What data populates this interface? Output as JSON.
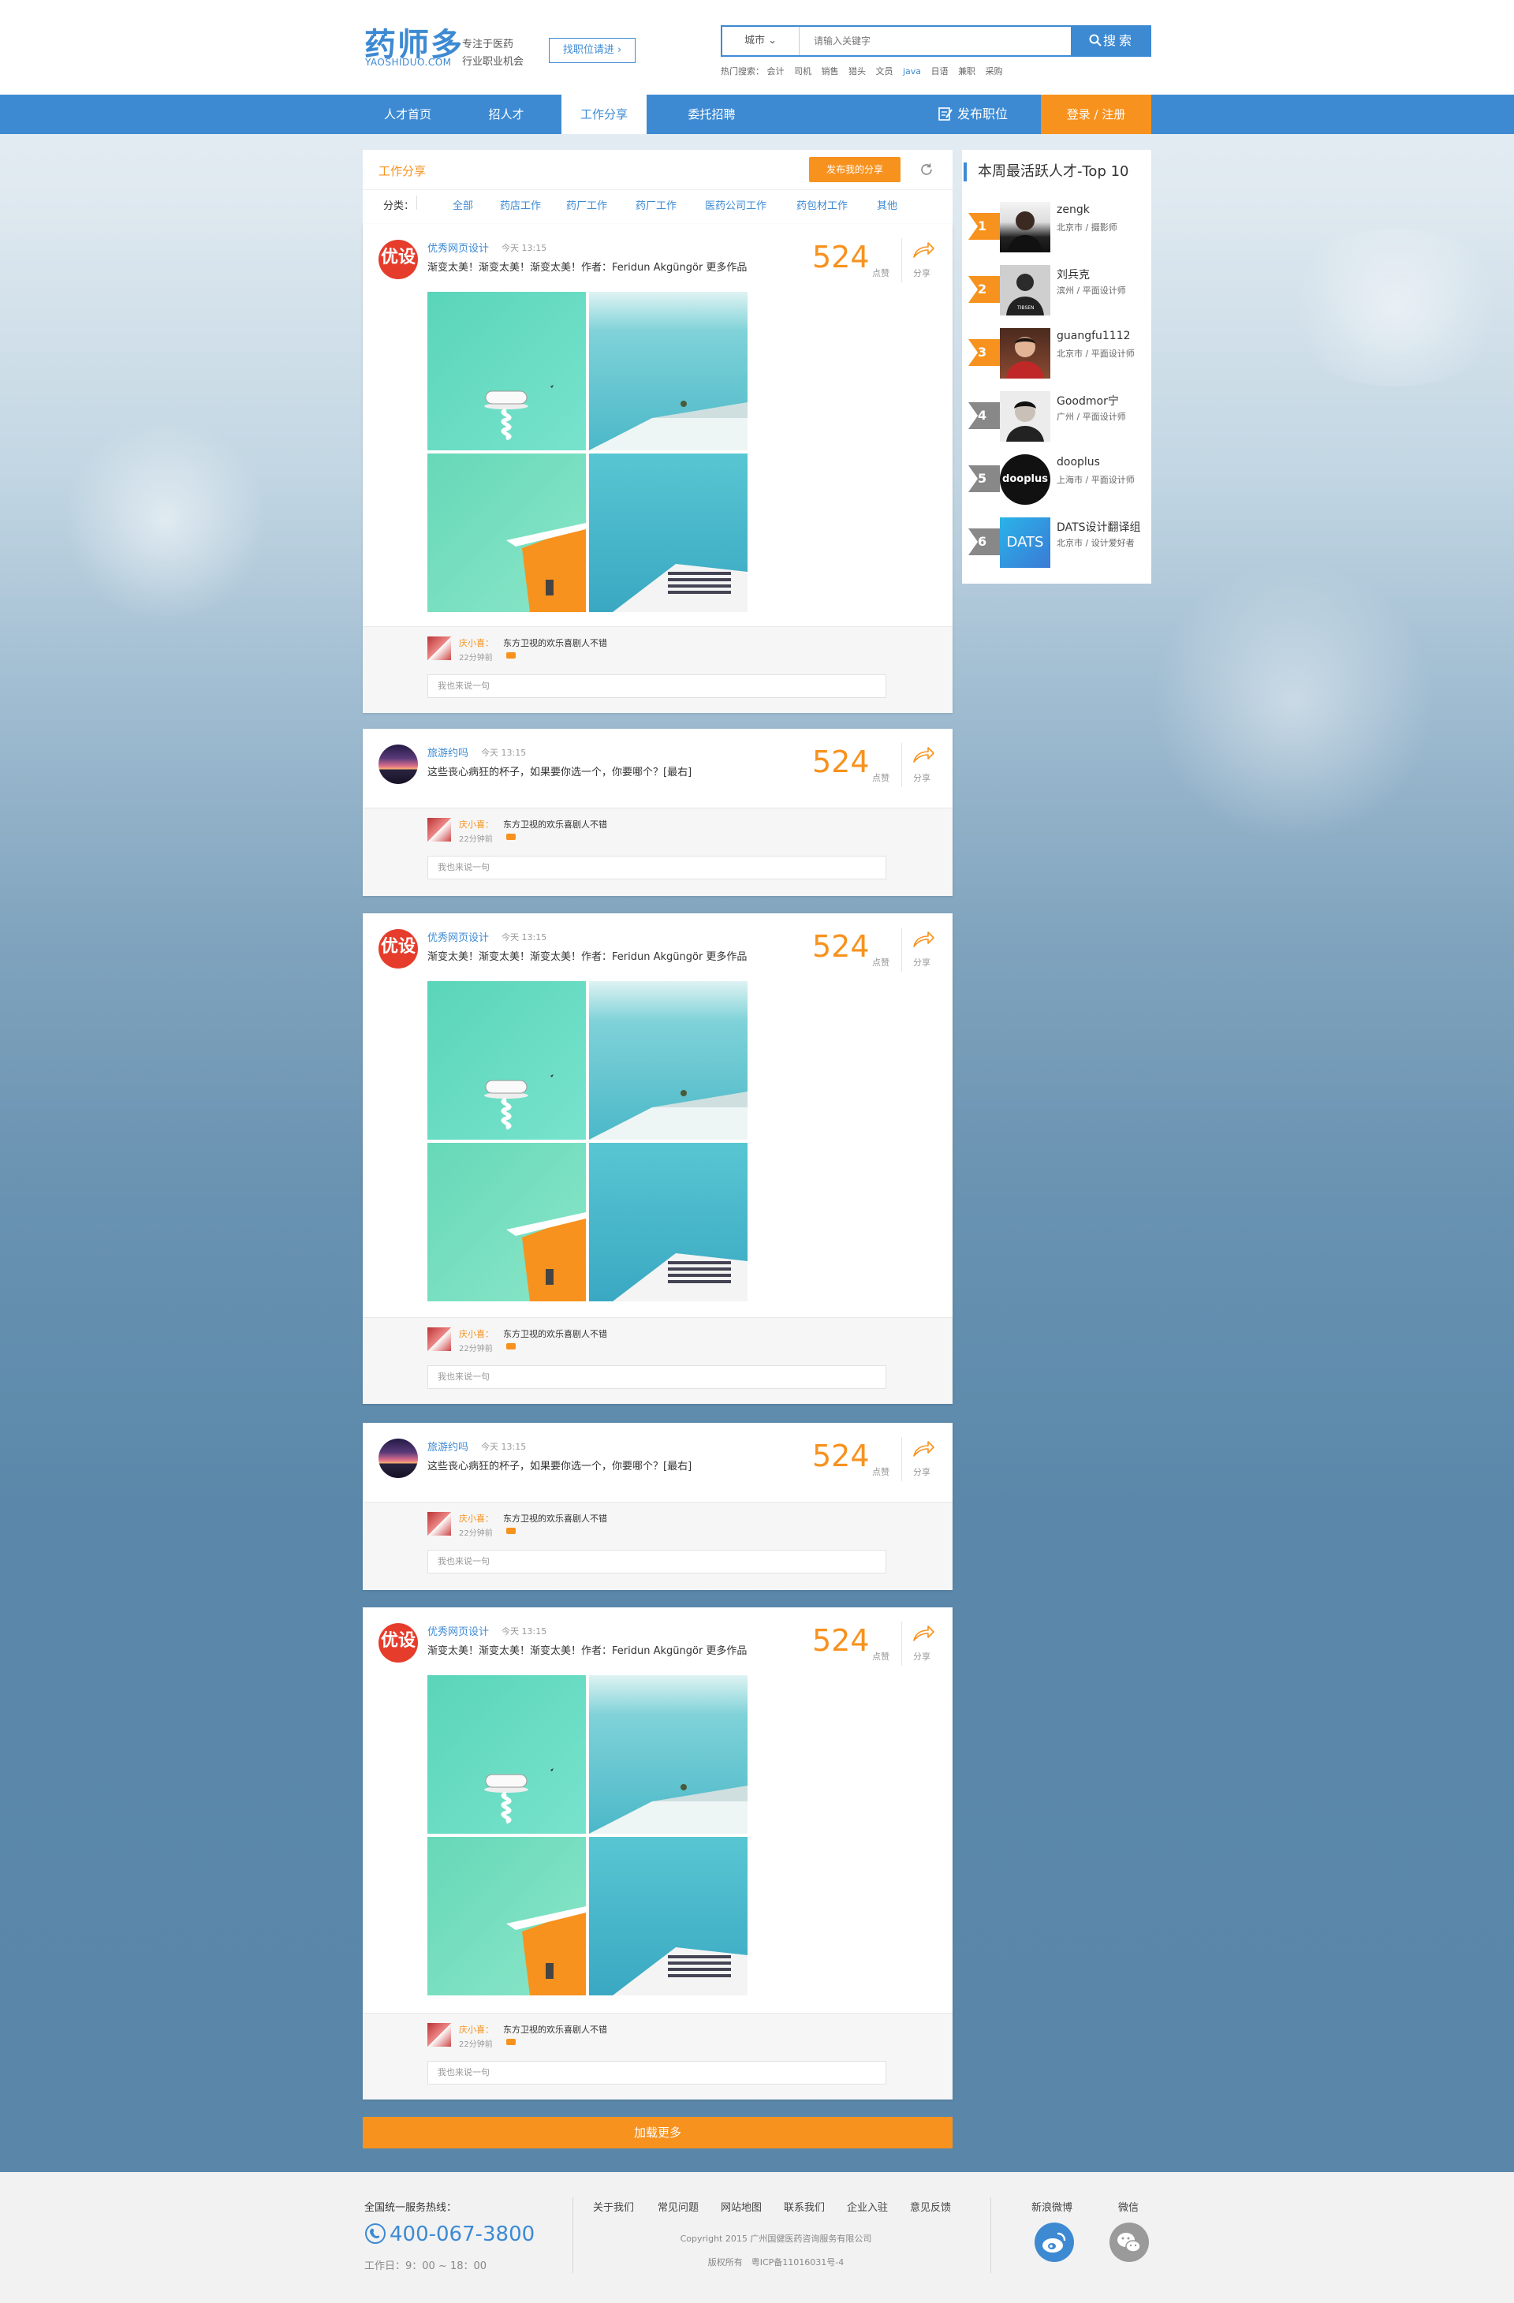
{
  "header": {
    "logo_cn": "药师多",
    "logo_en": "YAOSHIDUO.COM",
    "slogan_line1": "专注于医药",
    "slogan_line2": "行业职业机会",
    "find_job_btn": "找职位请进",
    "city_select": "城市",
    "search_placeholder": "请输入关键字",
    "search_btn": "搜索",
    "hot_label": "热门搜索：",
    "hot_terms": [
      "会计",
      "司机",
      "销售",
      "猎头",
      "文员",
      "java",
      "日语",
      "兼职",
      "采购"
    ]
  },
  "nav": {
    "items": [
      "人才首页",
      "招人才",
      "工作分享",
      "委托招聘"
    ],
    "active_index": 2,
    "post_job": "发布职位",
    "login": "登录 / 注册"
  },
  "feed": {
    "section_title": "工作分享",
    "share_btn": "发布我的分享",
    "category_label": "分类：",
    "categories": [
      "全部",
      "药店工作",
      "药厂工作",
      "药厂工作",
      "医药公司工作",
      "药包材工作",
      "其他"
    ],
    "posts": [
      {
        "user": "优秀网页设计",
        "avatar_text": "优设",
        "time": "今天 13:15",
        "text": "渐变太美！渐变太美！渐变太美！作者：Feridun Akgüngör 更多作品",
        "likes": "524",
        "like_label": "点赞",
        "share_label": "分享",
        "has_images": true
      },
      {
        "user": "旅游约吗",
        "time": "今天 13:15",
        "text": "这些丧心病狂的杯子，如果要你选一个，你要哪个？[最右]",
        "likes": "524",
        "like_label": "点赞",
        "share_label": "分享",
        "has_images": false
      },
      {
        "user": "优秀网页设计",
        "avatar_text": "优设",
        "time": "今天 13:15",
        "text": "渐变太美！渐变太美！渐变太美！作者：Feridun Akgüngör 更多作品",
        "likes": "524",
        "like_label": "点赞",
        "share_label": "分享",
        "has_images": true
      },
      {
        "user": "旅游约吗",
        "time": "今天 13:15",
        "text": "这些丧心病狂的杯子，如果要你选一个，你要哪个？[最右]",
        "likes": "524",
        "like_label": "点赞",
        "share_label": "分享",
        "has_images": false
      },
      {
        "user": "优秀网页设计",
        "avatar_text": "优设",
        "time": "今天 13:15",
        "text": "渐变太美！渐变太美！渐变太美！作者：Feridun Akgüngör 更多作品",
        "likes": "524",
        "like_label": "点赞",
        "share_label": "分享",
        "has_images": true
      }
    ],
    "comment": {
      "name": "庆小喜：",
      "text": "东方卫视的欢乐喜剧人不错",
      "ago": "22分钟前"
    },
    "comment_placeholder": "我也来说一句",
    "load_more": "加载更多"
  },
  "sidebar": {
    "title": "本周最活跃人才-Top 10",
    "top": [
      {
        "rank": "1",
        "name": "zengk",
        "sub": "北京市 / 摄影师",
        "color": "#f7921e"
      },
      {
        "rank": "2",
        "name": "刘兵克",
        "sub": "滨州 / 平面设计师",
        "color": "#f7921e"
      },
      {
        "rank": "3",
        "name": "guangfu1112",
        "sub": "北京市 / 平面设计师",
        "color": "#f7921e"
      },
      {
        "rank": "4",
        "name": "Goodmor宁",
        "sub": "广州 / 平面设计师",
        "color": "#888888"
      },
      {
        "rank": "5",
        "name": "dooplus",
        "sub": "上海市 / 平面设计师",
        "color": "#888888"
      },
      {
        "rank": "6",
        "name": "DATS设计翻译组",
        "sub": "北京市 / 设计爱好者",
        "color": "#888888"
      }
    ],
    "avatar_texts": {
      "dooplus": "dooplus",
      "dats": "DATS"
    }
  },
  "footer": {
    "hotline_label": "全国统一服务热线：",
    "phone": "400-067-3800",
    "hours": "工作日：9：00 ~ 18：00",
    "links": [
      "关于我们",
      "常见问题",
      "网站地图",
      "联系我们",
      "企业入驻",
      "意见反馈"
    ],
    "copyright": "Copyright 2015 广州国健医药咨询服务有限公司",
    "icp": "版权所有　粤ICP备11016031号-4",
    "weibo": "新浪微博",
    "wechat": "微信"
  },
  "colors": {
    "primary": "#3d8ad3",
    "accent": "#f7921e"
  }
}
